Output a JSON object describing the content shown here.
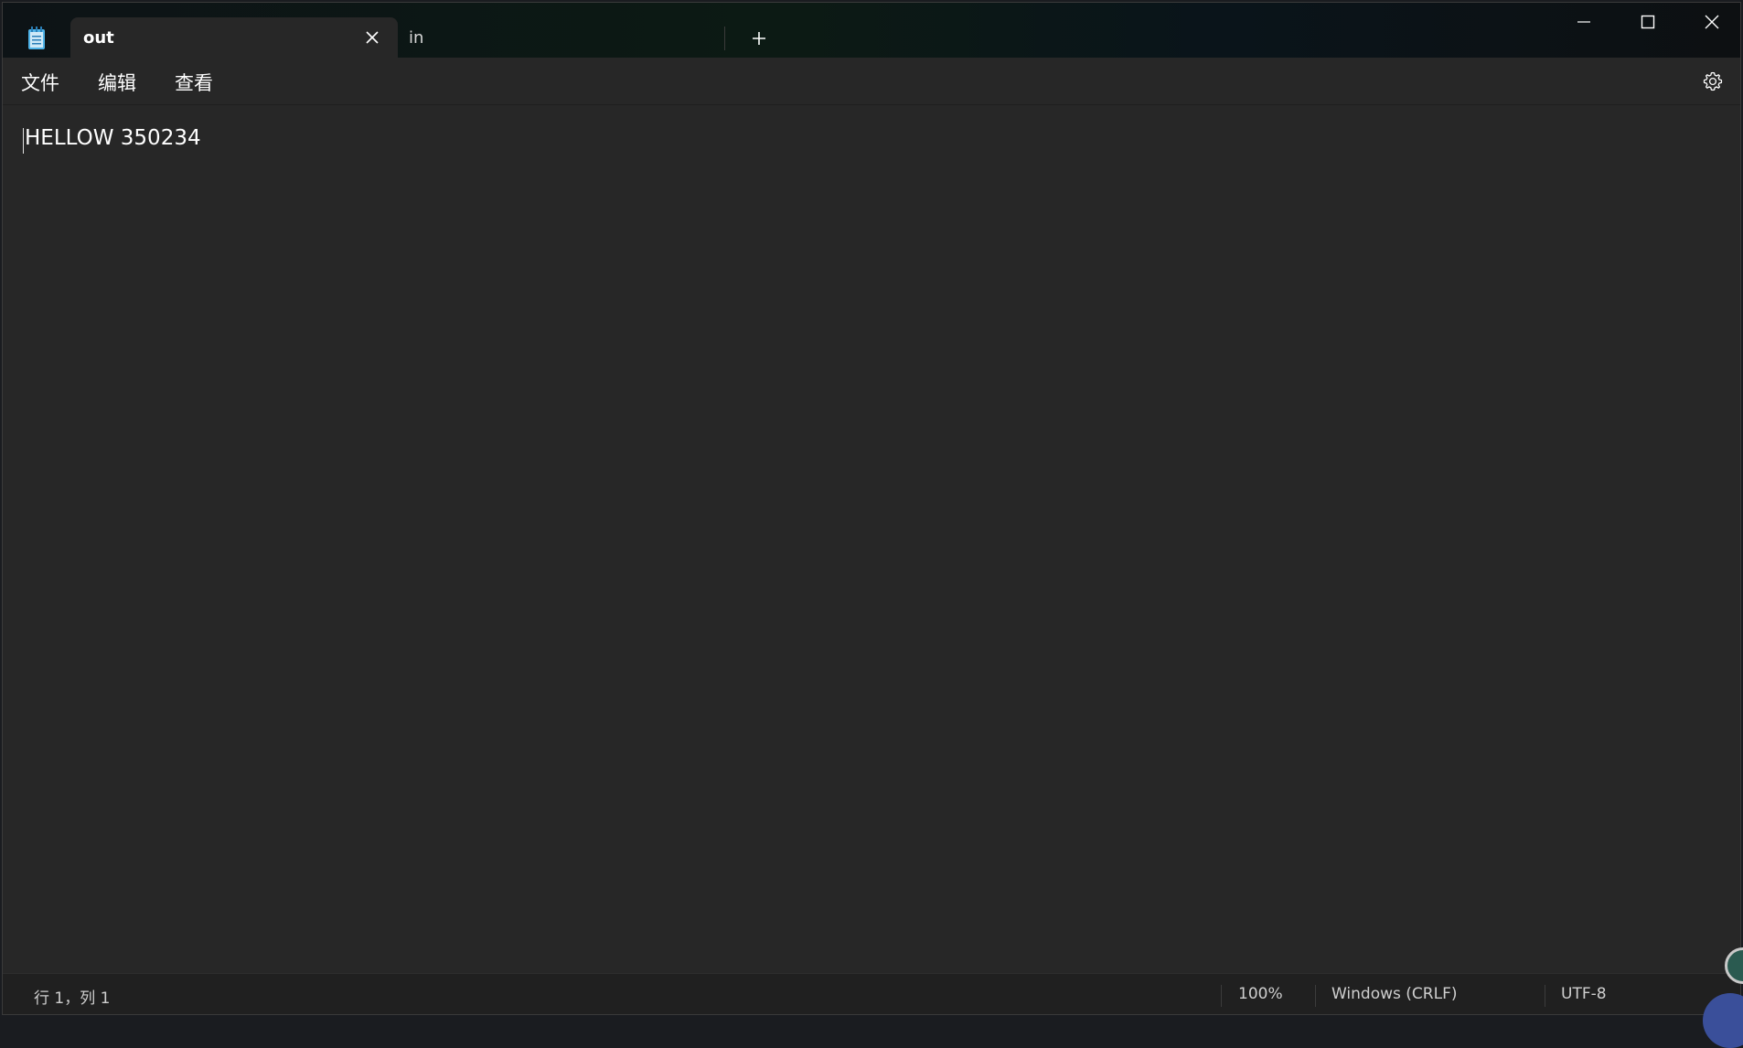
{
  "window": {
    "tabs": [
      {
        "label": "out",
        "active": true
      },
      {
        "label": "in",
        "active": false
      }
    ]
  },
  "menu": {
    "file": "文件",
    "edit": "编辑",
    "view": "查看"
  },
  "editor": {
    "content": "HELLOW 350234"
  },
  "status": {
    "position": "行 1，列 1",
    "zoom": "100%",
    "line_ending": "Windows (CRLF)",
    "encoding": "UTF-8"
  },
  "colors": {
    "background": "#272727",
    "titlebar": "#0d1316",
    "statusbar": "#202020",
    "text": "#ffffff",
    "app_icon_accent": "#4fb3e8"
  },
  "icons": {
    "app": "notepad-icon",
    "tab_close": "close-icon",
    "new_tab": "plus-icon",
    "minimize": "minimize-icon",
    "maximize": "maximize-icon",
    "close": "close-icon",
    "settings": "gear-icon"
  }
}
